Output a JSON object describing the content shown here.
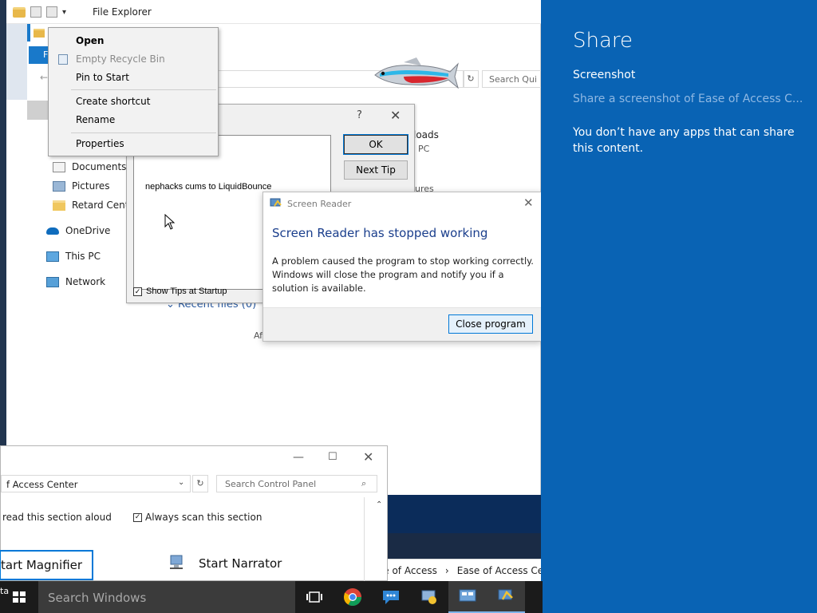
{
  "explorer": {
    "title": "File Explorer",
    "ribbon_file": "F",
    "search_placeholder": "Search Qui",
    "nav": [
      {
        "label": "Documents",
        "icon": "documents-icon"
      },
      {
        "label": "Pictures",
        "icon": "pictures-icon"
      },
      {
        "label": "Retard Centr",
        "icon": "folder-icon"
      },
      {
        "label": "OneDrive",
        "icon": "onedrive-icon"
      },
      {
        "label": "This PC",
        "icon": "this-pc-icon"
      },
      {
        "label": "Network",
        "icon": "network-icon"
      }
    ],
    "downloads": "loads",
    "downloads_sub": "PC",
    "fragment_right": "ures",
    "recent_files": "Recent files (0)",
    "recent_sub": "Af"
  },
  "context_menu": {
    "items": [
      {
        "label": "Open",
        "state": "bold"
      },
      {
        "label": "Empty Recycle Bin",
        "state": "disabled"
      },
      {
        "label": "Pin to Start",
        "state": "normal"
      },
      {
        "label": "Create shortcut",
        "state": "normal"
      },
      {
        "label": "Rename",
        "state": "normal"
      },
      {
        "label": "Properties",
        "state": "normal"
      }
    ]
  },
  "tip_dialog": {
    "help": "?",
    "close": "✕",
    "tip_text": "nephacks cums to LiquidBounce",
    "ok": "OK",
    "next_tip": "Next Tip",
    "show_tips": "Show Tips at Startup",
    "show_tips_checked": true
  },
  "error_dialog": {
    "title": "Screen Reader",
    "heading": "Screen Reader has stopped working",
    "body": "A problem caused the program to stop working correctly. Windows will close the program and notify you if a solution is available.",
    "button": "Close program"
  },
  "control_panel": {
    "address": "f Access Center",
    "search_placeholder": "Search Control Panel",
    "read_aloud": "read this section aloud",
    "always_scan": "Always scan this section",
    "start_magnifier": "tart Magnifier",
    "start_narrator": "Start Narrator",
    "breadcrumb_1": "se of Access",
    "breadcrumb_sep": "›",
    "breadcrumb_2": "Ease of Access Ce"
  },
  "share": {
    "title": "Share",
    "subtitle": "Screenshot",
    "description": "Share a screenshot of Ease of Access C...",
    "message": "You don’t have any apps that can share this content."
  },
  "taskbar": {
    "search_placeholder": "Search Windows",
    "desktop_fragment": "ta"
  },
  "colors": {
    "share_bg": "#0963b4",
    "accent": "#0078d7",
    "error_heading": "#1a3e8c",
    "taskbar": "#1b1b1b"
  }
}
